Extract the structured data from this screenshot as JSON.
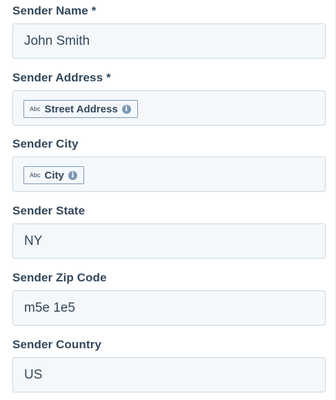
{
  "fields": [
    {
      "label": "Sender Name *",
      "value": "John Smith"
    },
    {
      "label": "Sender Address *",
      "token": {
        "type": "Abc",
        "label": "Street Address",
        "icon": "info-icon"
      }
    },
    {
      "label": "Sender City",
      "token": {
        "type": "Abc",
        "label": "City",
        "icon": "info-icon"
      }
    },
    {
      "label": "Sender State",
      "value": "NY"
    },
    {
      "label": "Sender Zip Code",
      "value": "m5e 1e5"
    },
    {
      "label": "Sender Country",
      "value": "US"
    }
  ]
}
